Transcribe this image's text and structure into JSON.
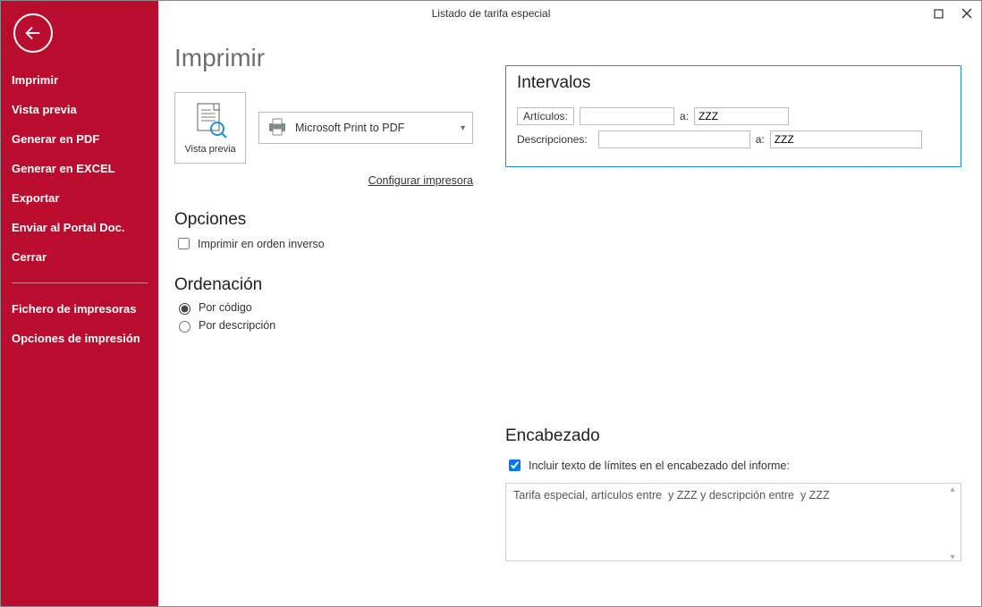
{
  "window": {
    "title": "Listado de tarifa especial"
  },
  "sidebar": {
    "items": [
      "Imprimir",
      "Vista previa",
      "Generar en PDF",
      "Generar en EXCEL",
      "Exportar",
      "Enviar al Portal Doc.",
      "Cerrar"
    ],
    "secondary": [
      "Fichero de impresoras",
      "Opciones de impresión"
    ]
  },
  "page": {
    "title": "Imprimir",
    "preview_label": "Vista previa",
    "printer_name": "Microsoft Print to PDF",
    "configure_link": "Configurar impresora"
  },
  "options": {
    "heading": "Opciones",
    "reverse_label": "Imprimir en orden inverso"
  },
  "sorting": {
    "heading": "Ordenación",
    "by_code": "Por código",
    "by_desc": "Por descripción"
  },
  "intervals": {
    "heading": "Intervalos",
    "articles_label": "Artículos:",
    "desc_label": "Descripciones:",
    "to_label": "a:",
    "articles_from": "",
    "articles_to": "ZZZ",
    "desc_from": "",
    "desc_to": "ZZZ"
  },
  "header_section": {
    "heading": "Encabezado",
    "include_label": "Incluir texto de límites en el encabezado del informe:",
    "text": "Tarifa especial, artículos entre  y ZZZ y descripción entre  y ZZZ"
  }
}
